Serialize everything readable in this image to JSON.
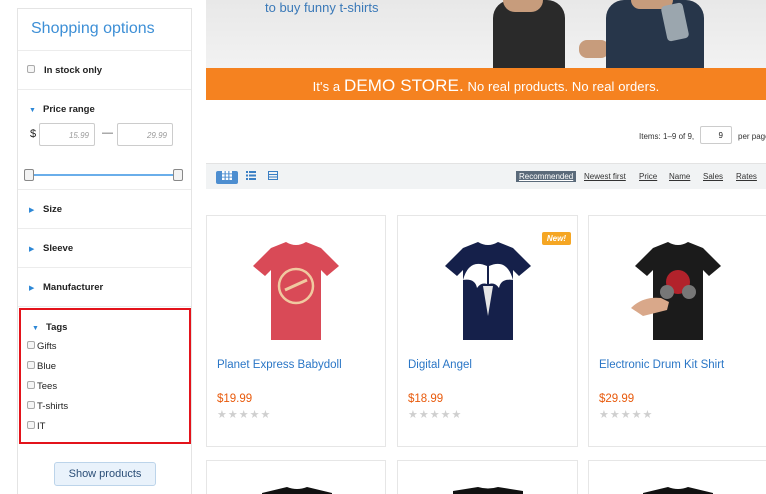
{
  "sidebar": {
    "title": "Shopping options",
    "in_stock_label": "In stock only",
    "price_range": {
      "label": "Price range",
      "currency": "$",
      "min_placeholder": "15.99",
      "max_placeholder": "29.99",
      "dash": "—"
    },
    "size_label": "Size",
    "sleeve_label": "Sleeve",
    "manufacturer_label": "Manufacturer",
    "tags": {
      "label": "Tags",
      "items": [
        "Gifts",
        "Blue",
        "Tees",
        "T-shirts",
        "IT"
      ]
    },
    "show_products_label": "Show products"
  },
  "banner": {
    "tagline": "to buy funny t-shirts",
    "demo_prefix": "It's a",
    "demo_big": "DEMO STORE.",
    "demo_suffix": "No real products. No real orders."
  },
  "pagination": {
    "items_info": "Items: 1–9 of 9,",
    "per_page_value": "9",
    "per_page_label": "per page"
  },
  "sort": {
    "options": [
      "Recommended",
      "Newest first",
      "Price",
      "Name",
      "Sales",
      "Rates"
    ],
    "active": "Recommended"
  },
  "products": [
    {
      "name": "Planet Express Babydoll",
      "price": "$19.99",
      "stars": "★★★★★",
      "badge": ""
    },
    {
      "name": "Digital Angel",
      "price": "$18.99",
      "stars": "★★★★★",
      "badge": "New!"
    },
    {
      "name": "Electronic Drum Kit Shirt",
      "price": "$29.99",
      "stars": "★★★★★",
      "badge": ""
    }
  ],
  "colors": {
    "accent": "#3d8fd6",
    "demo_bar": "#f58220",
    "price": "#e85a0c",
    "highlight_border": "#e3131b"
  },
  "icons": [
    "chevron-down-icon",
    "chevron-right-icon",
    "grid-view-icon",
    "list-view-icon",
    "table-view-icon",
    "star-icon"
  ]
}
